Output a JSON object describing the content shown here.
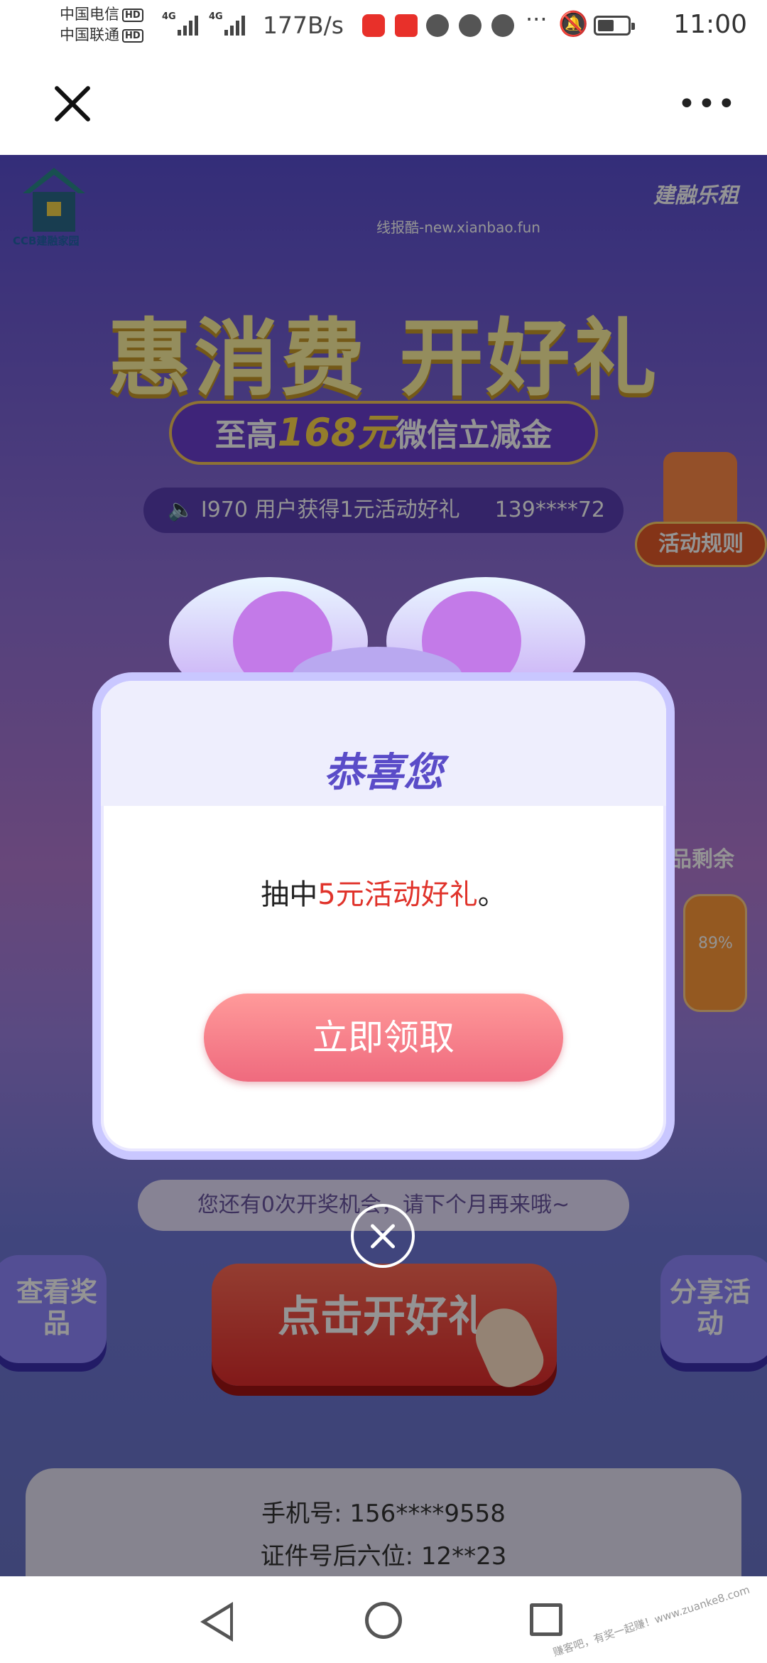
{
  "status_bar": {
    "carrier1": "中国电信",
    "carrier2": "中国联通",
    "hd": "HD",
    "net": "4G",
    "speed": "177B/s",
    "time": "11:00",
    "icons": [
      "signal-icon",
      "app-icon",
      "app-icon",
      "browser-icon",
      "message-icon",
      "wechat-icon",
      "more-icon",
      "mute-icon",
      "battery-icon"
    ]
  },
  "app_bar": {
    "close_icon": "close-icon",
    "more": "•••"
  },
  "page": {
    "logo_text": "CCB建融家园",
    "brand": "建融乐租",
    "watermark": "线报酷-new.xianbao.fun",
    "headline": "惠消费 开好礼",
    "subtitle_pre": "至高",
    "subtitle_amount": "168元",
    "subtitle_post": "微信立减金",
    "ticker_text": "I970 用户获得1元活动好礼",
    "ticker_phone": "139****72",
    "rules_label": "活动规则",
    "remaining_label": "品剩余",
    "remaining_percent": "89%",
    "chances_text": "您还有0次开奖机会，请下个月再来哦~",
    "view_prizes": "查看奖品",
    "draw_button": "点击开好礼",
    "share": "分享活动",
    "phone_line": "手机号: 156****9558",
    "id_line": "证件号后六位: 12**23"
  },
  "modal": {
    "title": "恭喜您",
    "msg_pre": "抽中",
    "msg_highlight": "5元活动好礼",
    "msg_post": "。",
    "claim_button": "立即领取",
    "dismiss_icon": "close-circle-icon"
  },
  "nav_bar": {
    "icons": [
      "back-icon",
      "home-icon",
      "recents-icon"
    ]
  },
  "corner_watermark": "赚客吧，有奖一起赚！www.zuanke8.com"
}
